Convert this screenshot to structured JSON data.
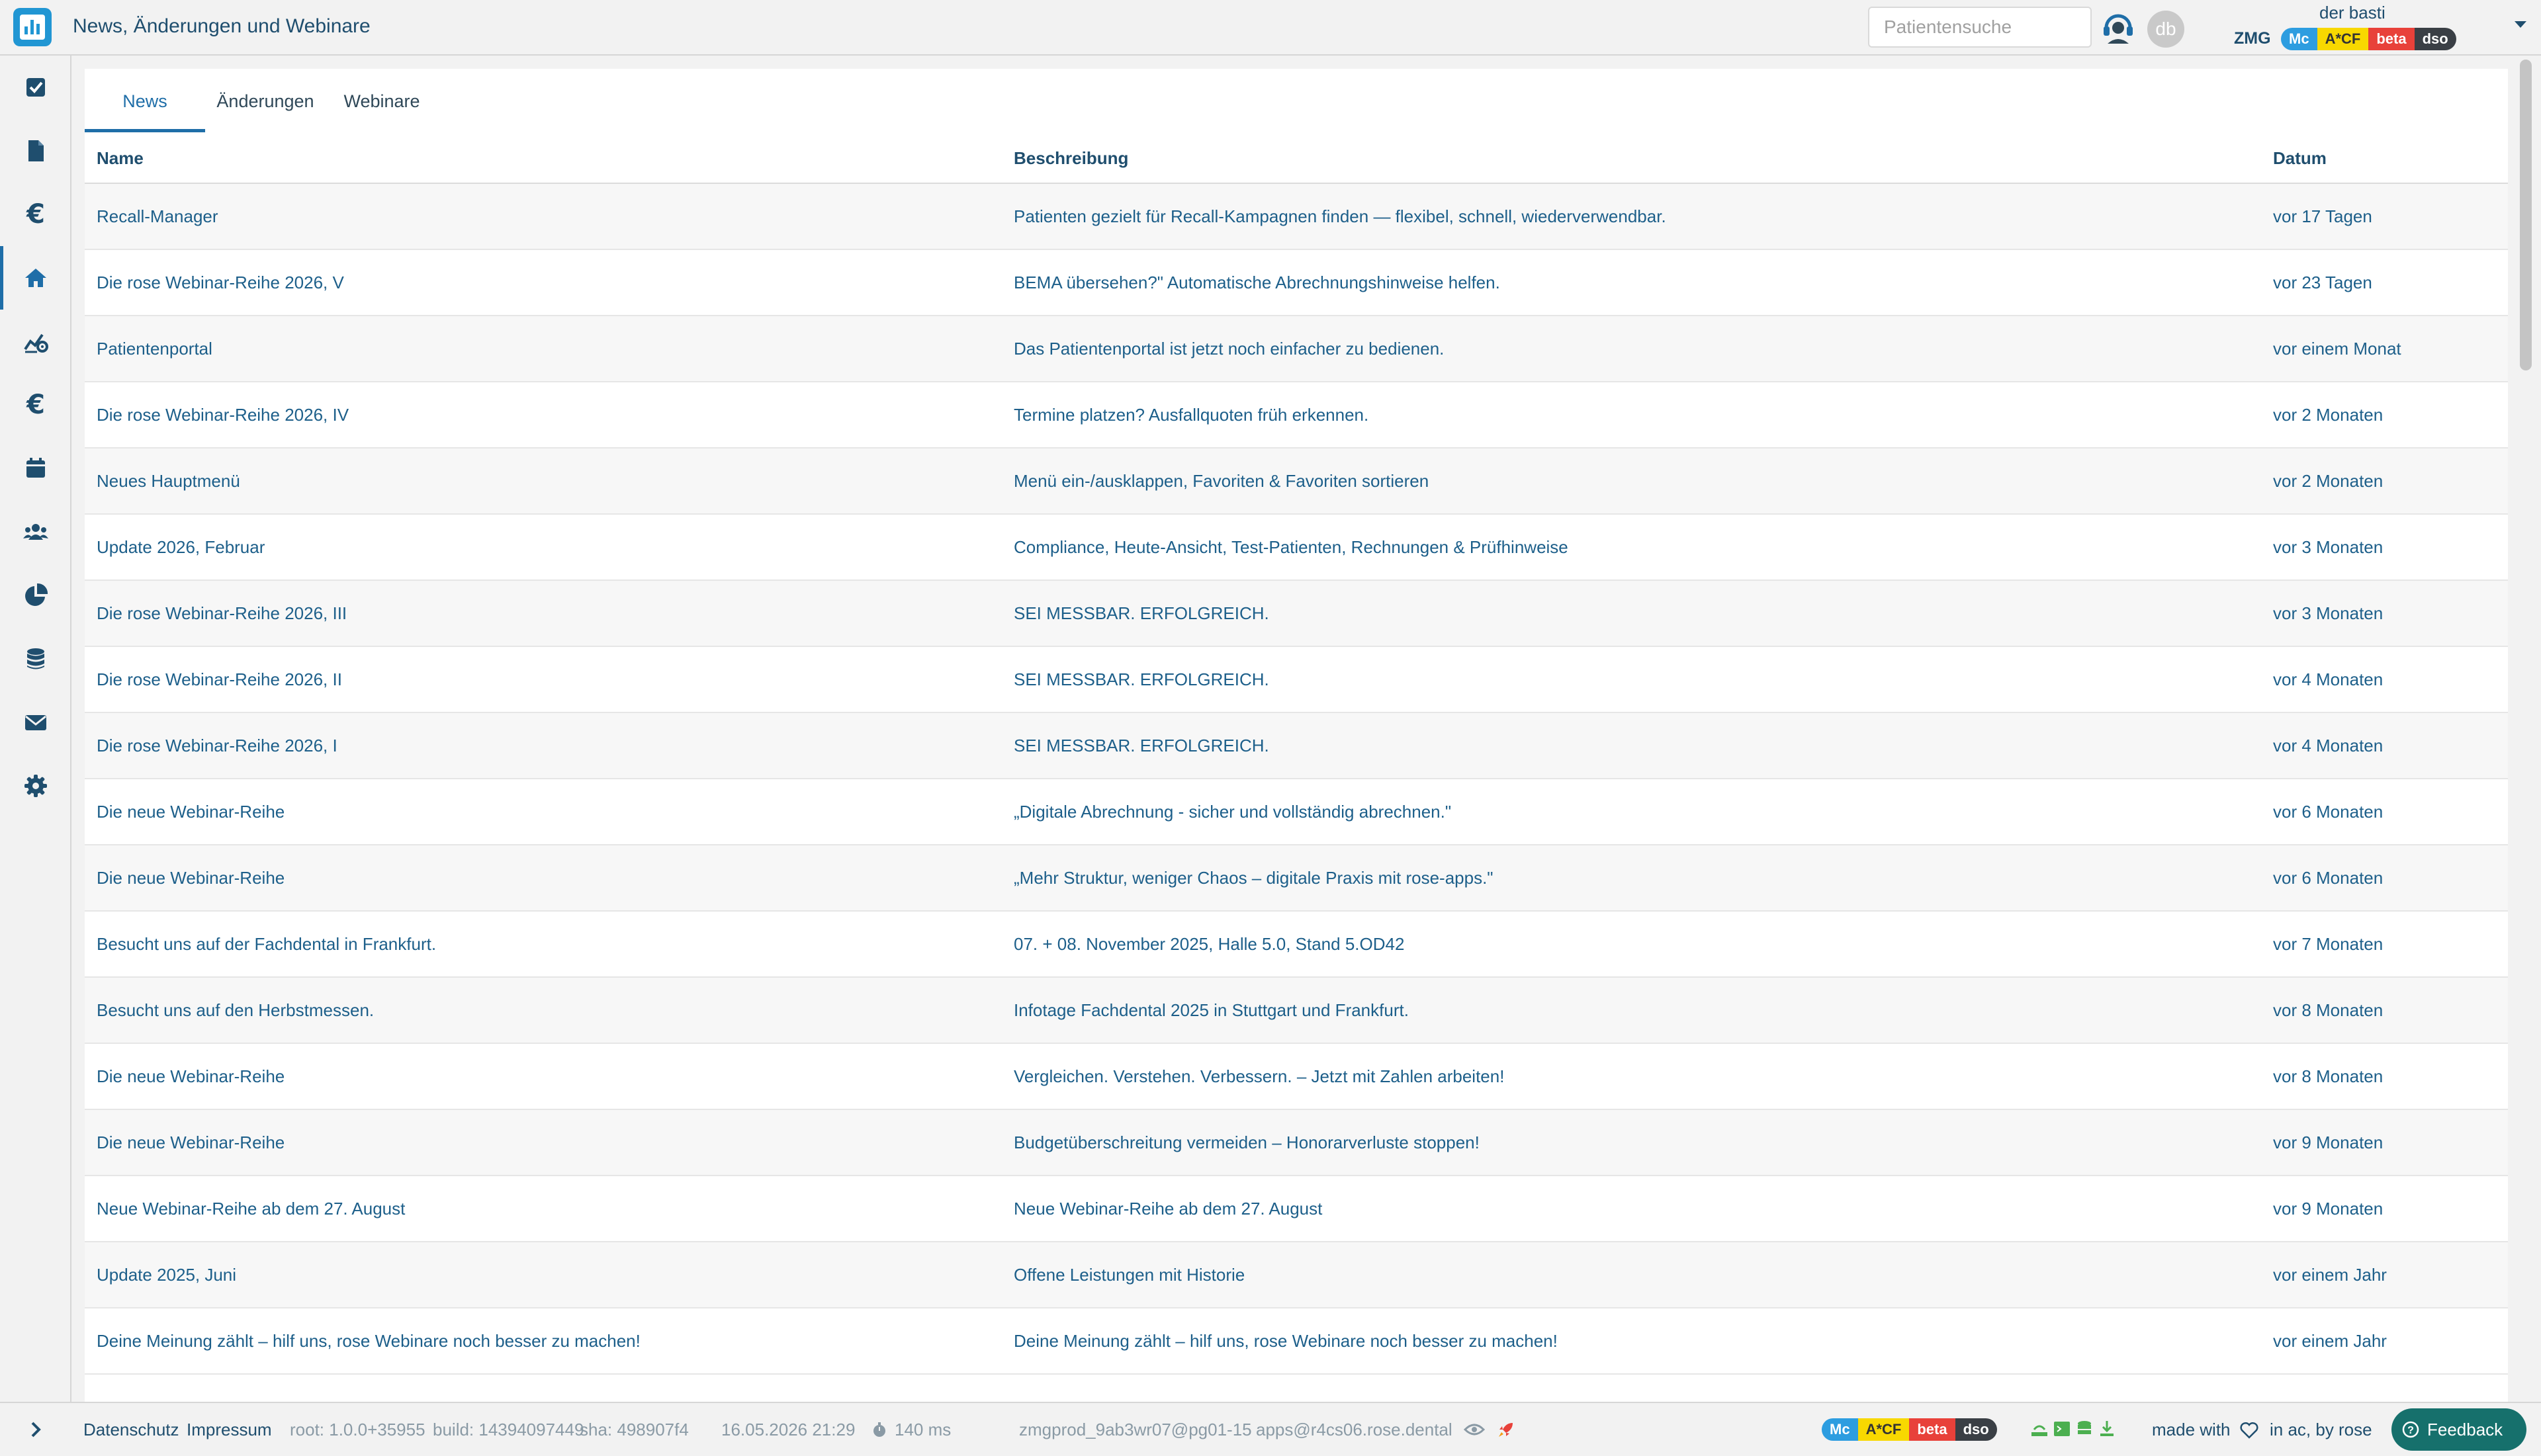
{
  "header": {
    "title": "News, Änderungen und Webinare",
    "search_placeholder": "Patientensuche",
    "avatar_initials": "db",
    "user_name": "der basti",
    "org": "ZMG",
    "badges": [
      "Mc",
      "A*CF",
      "beta",
      "dso"
    ]
  },
  "tabs": [
    "News",
    "Änderungen",
    "Webinare"
  ],
  "active_tab": "News",
  "table": {
    "columns": [
      "Name",
      "Beschreibung",
      "Datum"
    ],
    "rows": [
      [
        "Recall-Manager",
        "Patienten gezielt für Recall-Kampagnen finden — flexibel, schnell, wiederverwendbar.",
        "vor 17 Tagen"
      ],
      [
        "Die rose Webinar-Reihe 2026, V",
        "BEMA übersehen?\" Automatische Abrechnungshinweise helfen.",
        "vor 23 Tagen"
      ],
      [
        "Patientenportal",
        "Das Patientenportal ist jetzt noch einfacher zu bedienen.",
        "vor einem Monat"
      ],
      [
        "Die rose Webinar-Reihe 2026, IV",
        "Termine platzen? Ausfallquoten früh erkennen.",
        "vor 2 Monaten"
      ],
      [
        "Neues Hauptmenü",
        "Menü ein-/ausklappen, Favoriten & Favoriten sortieren",
        "vor 2 Monaten"
      ],
      [
        "Update 2026, Februar",
        "Compliance, Heute-Ansicht, Test-Patienten, Rechnungen & Prüfhinweise",
        "vor 3 Monaten"
      ],
      [
        "Die rose Webinar-Reihe 2026, III",
        "SEI MESSBAR. ERFOLGREICH.",
        "vor 3 Monaten"
      ],
      [
        "Die rose Webinar-Reihe 2026, II",
        "SEI MESSBAR. ERFOLGREICH.",
        "vor 4 Monaten"
      ],
      [
        "Die rose Webinar-Reihe 2026, I",
        "SEI MESSBAR. ERFOLGREICH.",
        "vor 4 Monaten"
      ],
      [
        "Die neue Webinar-Reihe",
        "„Digitale Abrechnung - sicher und vollständig abrechnen.\"",
        "vor 6 Monaten"
      ],
      [
        "Die neue Webinar-Reihe",
        "„Mehr Struktur, weniger Chaos – digitale Praxis mit rose-apps.\"",
        "vor 6 Monaten"
      ],
      [
        "Besucht uns auf der Fachdental in Frankfurt.",
        "07. + 08. November 2025, Halle 5.0, Stand 5.OD42",
        "vor 7 Monaten"
      ],
      [
        "Besucht uns auf den Herbstmessen.",
        "Infotage Fachdental 2025 in Stuttgart und Frankfurt.",
        "vor 8 Monaten"
      ],
      [
        "Die neue Webinar-Reihe",
        "Vergleichen. Verstehen. Verbessern. – Jetzt mit Zahlen arbeiten!",
        "vor 8 Monaten"
      ],
      [
        "Die neue Webinar-Reihe",
        "Budgetüberschreitung vermeiden – Honorarverluste stoppen!",
        "vor 9 Monaten"
      ],
      [
        "Neue Webinar-Reihe ab dem 27. August",
        "Neue Webinar-Reihe ab dem 27. August",
        "vor 9 Monaten"
      ],
      [
        "Update 2025, Juni",
        "Offene Leistungen mit Historie",
        "vor einem Jahr"
      ],
      [
        "Deine Meinung zählt – hilf uns, rose Webinare noch besser zu machen!",
        "Deine Meinung zählt – hilf uns, rose Webinare noch besser zu machen!",
        "vor einem Jahr"
      ]
    ]
  },
  "sidebar": {
    "items": [
      "check-square-icon",
      "document-icon",
      "euro-icon",
      "home-icon",
      "chart-settings-icon",
      "euro-icon",
      "calendar-icon",
      "users-icon",
      "pie-chart-icon",
      "database-icon",
      "mail-icon",
      "gear-icon"
    ],
    "active_index": 3
  },
  "footer": {
    "datenschutz": "Datenschutz",
    "impressum": "Impressum",
    "root": "root: 1.0.0+35955",
    "build": "build: 14394097449",
    "sha": "sha: 498907f4",
    "datetime": "16.05.2026 21:29",
    "latency": "140 ms",
    "server": "zmgprod_9ab3wr07@pg01-15",
    "apps_host": "apps@r4cs06.rose.dental",
    "made_with": "made with",
    "location": "in ac, by",
    "brand": "rose",
    "feedback": "Feedback"
  },
  "colors": {
    "accent": "#1f6ea8",
    "text": "#1d5f8a",
    "brand": "#2196d3",
    "feedback": "#16706c"
  }
}
